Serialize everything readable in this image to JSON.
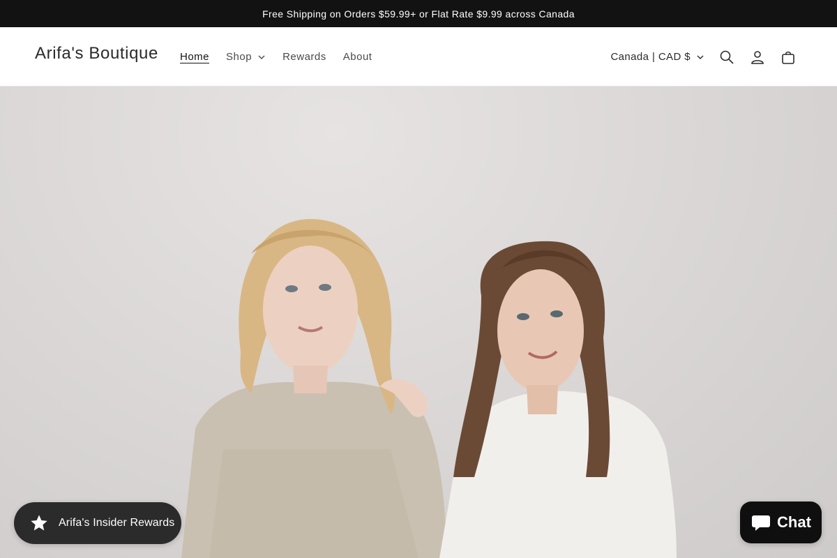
{
  "announcement": {
    "text": "Free Shipping on Orders $59.99+ or Flat Rate $9.99 across Canada"
  },
  "header": {
    "brand": "Arifa's Boutique",
    "nav": [
      {
        "label": "Home",
        "active": true
      },
      {
        "label": "Shop",
        "has_dropdown": true
      },
      {
        "label": "Rewards"
      },
      {
        "label": "About"
      }
    ],
    "locale": "Canada | CAD $",
    "icons": [
      "search-icon",
      "account-icon",
      "cart-icon"
    ]
  },
  "hero": {
    "image": "two-women-in-neutral-dresses",
    "background_color": "#dcd9d8"
  },
  "rewards_launcher": {
    "label": "Arifa's Insider Rewards",
    "icon": "star-icon",
    "color": "#2b2b2b"
  },
  "chat": {
    "label": "Chat",
    "icon": "chat-bubble-icon",
    "color": "#0f0f0f"
  },
  "colors": {
    "announcement_bg": "#121212",
    "text": "#121212",
    "muted_text": "#4a4a4a"
  }
}
